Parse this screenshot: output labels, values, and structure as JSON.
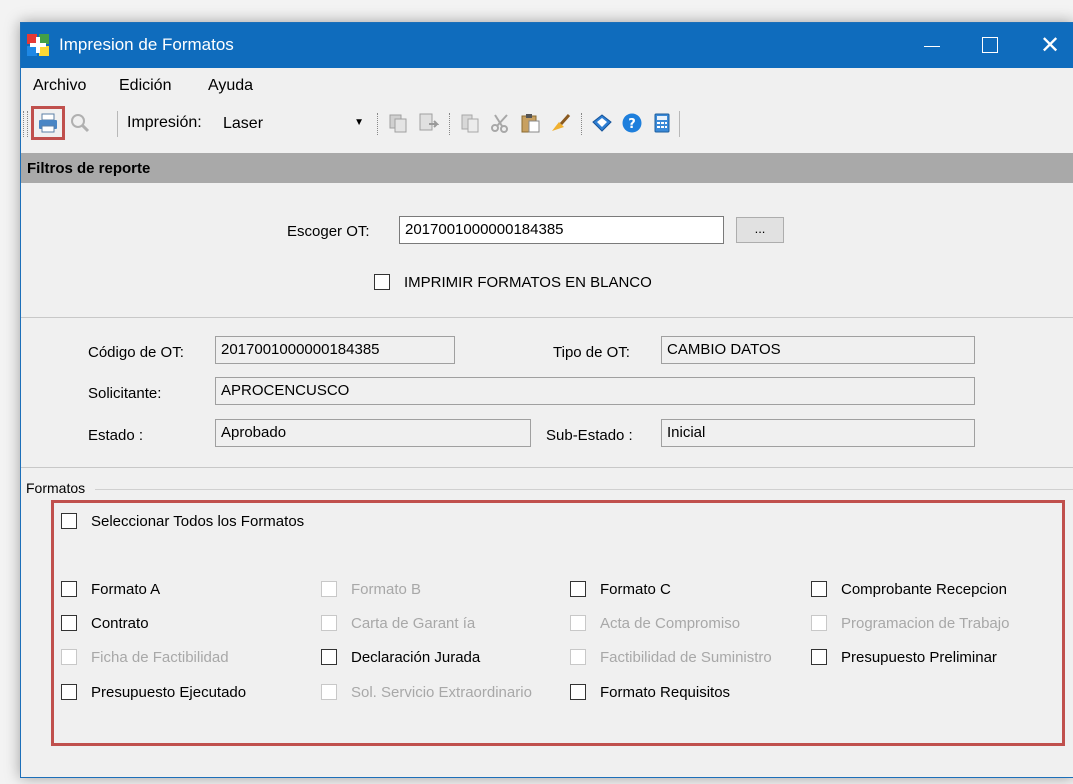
{
  "window": {
    "title": "Impresion de Formatos",
    "controls": {
      "minimize": "—",
      "maximize": "□",
      "close": "✕"
    }
  },
  "menu": [
    "Archivo",
    "Edición",
    "Ayuda"
  ],
  "toolbar": {
    "impresion_label": "Impresión:",
    "impresion_value": "Laser",
    "icons": [
      "print-icon",
      "preview-icon",
      "copy-icon",
      "export-icon",
      "paste-icon",
      "cut-icon",
      "clipboard-icon",
      "clear-icon",
      "book-icon",
      "help-icon",
      "calculator-icon"
    ]
  },
  "filters": {
    "band_title": "Filtros de reporte",
    "escoger_label": "Escoger OT:",
    "escoger_value": "2017001000000184385",
    "browse_label": "...",
    "blank_label": "IMPRIMIR FORMATOS EN BLANCO"
  },
  "info": {
    "codigo_label": "Código de OT:",
    "codigo_value": "2017001000000184385",
    "tipo_label": "Tipo de OT:",
    "tipo_value": "CAMBIO DATOS",
    "solicitante_label": "Solicitante:",
    "solicitante_value": "APROCENCUSCO",
    "estado_label": "Estado :",
    "estado_value": "Aprobado",
    "subestado_label": "Sub-Estado :",
    "subestado_value": "Inicial"
  },
  "formatos": {
    "group_title": "Formatos",
    "select_all": "Seleccionar Todos los Formatos",
    "items": [
      {
        "label": "Formato A",
        "enabled": true
      },
      {
        "label": "Formato B",
        "enabled": false
      },
      {
        "label": "Formato C",
        "enabled": true
      },
      {
        "label": "Comprobante Recepcion",
        "enabled": true
      },
      {
        "label": "Contrato",
        "enabled": true
      },
      {
        "label": "Carta de Garant ía",
        "enabled": false
      },
      {
        "label": "Acta de Compromiso",
        "enabled": false
      },
      {
        "label": "Programacion de Trabajo",
        "enabled": false
      },
      {
        "label": "Ficha de Factibilidad",
        "enabled": false
      },
      {
        "label": "Declaración Jurada",
        "enabled": true
      },
      {
        "label": "Factibilidad de Suministro",
        "enabled": false
      },
      {
        "label": "Presupuesto Preliminar",
        "enabled": true
      },
      {
        "label": "Presupuesto Ejecutado",
        "enabled": true
      },
      {
        "label": "Sol. Servicio Extraordinario",
        "enabled": false
      },
      {
        "label": "Formato Requisitos",
        "enabled": true
      }
    ]
  },
  "colors": {
    "titlebar": "#0f6cbd",
    "highlight": "#c0504d",
    "band": "#a9a9a9"
  }
}
